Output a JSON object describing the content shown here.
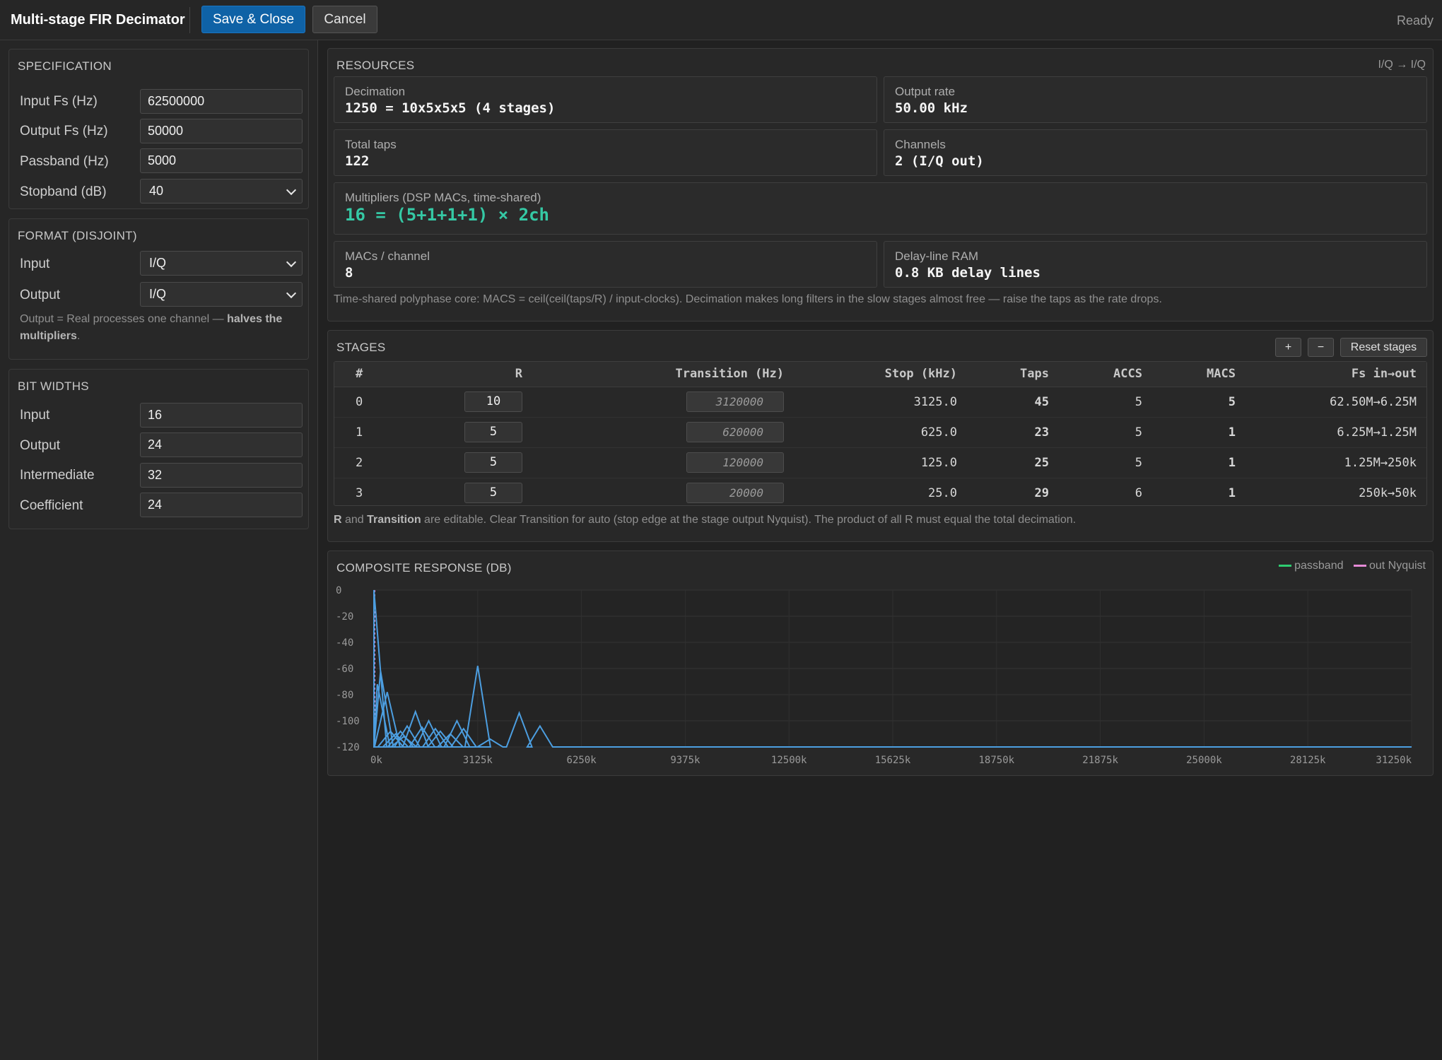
{
  "topbar": {
    "title": "Multi-stage FIR Decimator",
    "save_label": "Save & Close",
    "cancel_label": "Cancel",
    "status": "Ready"
  },
  "specification": {
    "title": "SPECIFICATION",
    "fields": [
      {
        "label": "Input Fs (Hz)",
        "value": "62500000"
      },
      {
        "label": "Output Fs (Hz)",
        "value": "50000"
      },
      {
        "label": "Passband (Hz)",
        "value": "5000"
      }
    ],
    "stopband": {
      "label": "Stopband (dB)",
      "value": "40"
    }
  },
  "format": {
    "title": "FORMAT (DISJOINT)",
    "input": {
      "label": "Input",
      "value": "I/Q"
    },
    "output": {
      "label": "Output",
      "value": "I/Q"
    },
    "note_prefix": "Output = Real processes one channel — ",
    "note_bold": "halves the multipliers",
    "note_suffix": "."
  },
  "bit_widths": {
    "title": "BIT WIDTHS",
    "fields": [
      {
        "label": "Input",
        "value": "16"
      },
      {
        "label": "Output",
        "value": "24"
      },
      {
        "label": "Intermediate",
        "value": "32"
      },
      {
        "label": "Coefficient",
        "value": "24"
      }
    ]
  },
  "resources": {
    "title": "RESOURCES",
    "tag": "I/Q → I/Q",
    "decimation": {
      "label": "Decimation",
      "value": "1250 = 10x5x5x5 (4 stages)"
    },
    "output_rate": {
      "label": "Output rate",
      "value": "50.00 kHz"
    },
    "total_taps": {
      "label": "Total taps",
      "value": "122"
    },
    "channels": {
      "label": "Channels",
      "value": "2 (I/Q out)"
    },
    "multipliers": {
      "label": "Multipliers (DSP MACs, time-shared)",
      "value": "16 = (5+1+1+1) × 2ch"
    },
    "macs_per_channel": {
      "label": "MACs / channel",
      "value": "8"
    },
    "delay_ram": {
      "label": "Delay-line RAM",
      "value": "0.8 KB delay lines"
    },
    "note": "Time-shared polyphase core: MACS = ceil(ceil(taps/R) / input-clocks). Decimation makes long filters in the slow stages almost free — raise the taps as the rate drops."
  },
  "stages": {
    "title": "STAGES",
    "add_label": "+",
    "remove_label": "−",
    "reset_label": "Reset stages",
    "columns": [
      "#",
      "R",
      "Transition (Hz)",
      "Stop (kHz)",
      "Taps",
      "ACCS",
      "MACS",
      "Fs in→out"
    ],
    "rows": [
      {
        "index": "0",
        "r": "10",
        "transition": "3120000",
        "stop": "3125.0",
        "taps": "45",
        "accs": "5",
        "macs": "5",
        "fs": "62.50M→6.25M"
      },
      {
        "index": "1",
        "r": "5",
        "transition": "620000",
        "stop": "625.0",
        "taps": "23",
        "accs": "5",
        "macs": "1",
        "fs": "6.25M→1.25M"
      },
      {
        "index": "2",
        "r": "5",
        "transition": "120000",
        "stop": "125.0",
        "taps": "25",
        "accs": "5",
        "macs": "1",
        "fs": "1.25M→250k"
      },
      {
        "index": "3",
        "r": "5",
        "transition": "20000",
        "stop": "25.0",
        "taps": "29",
        "accs": "6",
        "macs": "1",
        "fs": "250k→50k"
      }
    ],
    "note_r": "R",
    "note_and": " and ",
    "note_transition": "Transition",
    "note_rest": " are editable. Clear Transition for auto (stop edge at the stage output Nyquist). The product of all R must equal the total decimation."
  },
  "chart_data": {
    "type": "line",
    "title": "COMPOSITE RESPONSE (DB)",
    "legend": [
      {
        "name": "passband",
        "color": "#2ecc71"
      },
      {
        "name": "out Nyquist",
        "color": "#e58ad6"
      }
    ],
    "line_color": "#4c9ee0",
    "xlim": [
      0,
      31250
    ],
    "ylim": [
      -120,
      0
    ],
    "x_ticks": [
      "0k",
      "3125k",
      "6250k",
      "9375k",
      "12500k",
      "15625k",
      "18750k",
      "21875k",
      "25000k",
      "28125k",
      "31250k"
    ],
    "y_ticks": [
      "0",
      "-20",
      "-40",
      "-60",
      "-80",
      "-100",
      "-120"
    ],
    "grid": true,
    "floor": -120,
    "peaks": [
      {
        "x": 0,
        "y": 0
      },
      {
        "x": 100,
        "y": -72
      },
      {
        "x": 200,
        "y": -62
      },
      {
        "x": 400,
        "y": -78
      },
      {
        "x": 500,
        "y": -108
      },
      {
        "x": 650,
        "y": -110
      },
      {
        "x": 800,
        "y": -108
      },
      {
        "x": 900,
        "y": -112
      },
      {
        "x": 1000,
        "y": -104
      },
      {
        "x": 1250,
        "y": -93
      },
      {
        "x": 1450,
        "y": -105
      },
      {
        "x": 1650,
        "y": -100
      },
      {
        "x": 1850,
        "y": -106
      },
      {
        "x": 2000,
        "y": -108
      },
      {
        "x": 2300,
        "y": -110
      },
      {
        "x": 2500,
        "y": -100
      },
      {
        "x": 2700,
        "y": -106
      },
      {
        "x": 3125,
        "y": -58
      },
      {
        "x": 3500,
        "y": -114
      },
      {
        "x": 4375,
        "y": -94
      },
      {
        "x": 5000,
        "y": -104
      },
      {
        "x": 5000,
        "y": -104
      },
      {
        "x": 5000,
        "y": -104
      },
      {
        "x": 5000,
        "y": -104
      },
      {
        "x": 5000,
        "y": -104
      },
      {
        "x": 5000,
        "y": -104
      },
      {
        "x": 5000,
        "y": -104
      },
      {
        "x": 5000,
        "y": -104
      },
      {
        "x": 5000,
        "y": -104
      },
      {
        "x": 5000,
        "y": -104
      },
      {
        "x": 5000,
        "y": -104
      },
      {
        "x": 5000,
        "y": -104
      },
      {
        "x": 5000,
        "y": -104
      },
      {
        "x": 5000,
        "y": -104
      },
      {
        "x": 5000,
        "y": -104
      }
    ]
  }
}
